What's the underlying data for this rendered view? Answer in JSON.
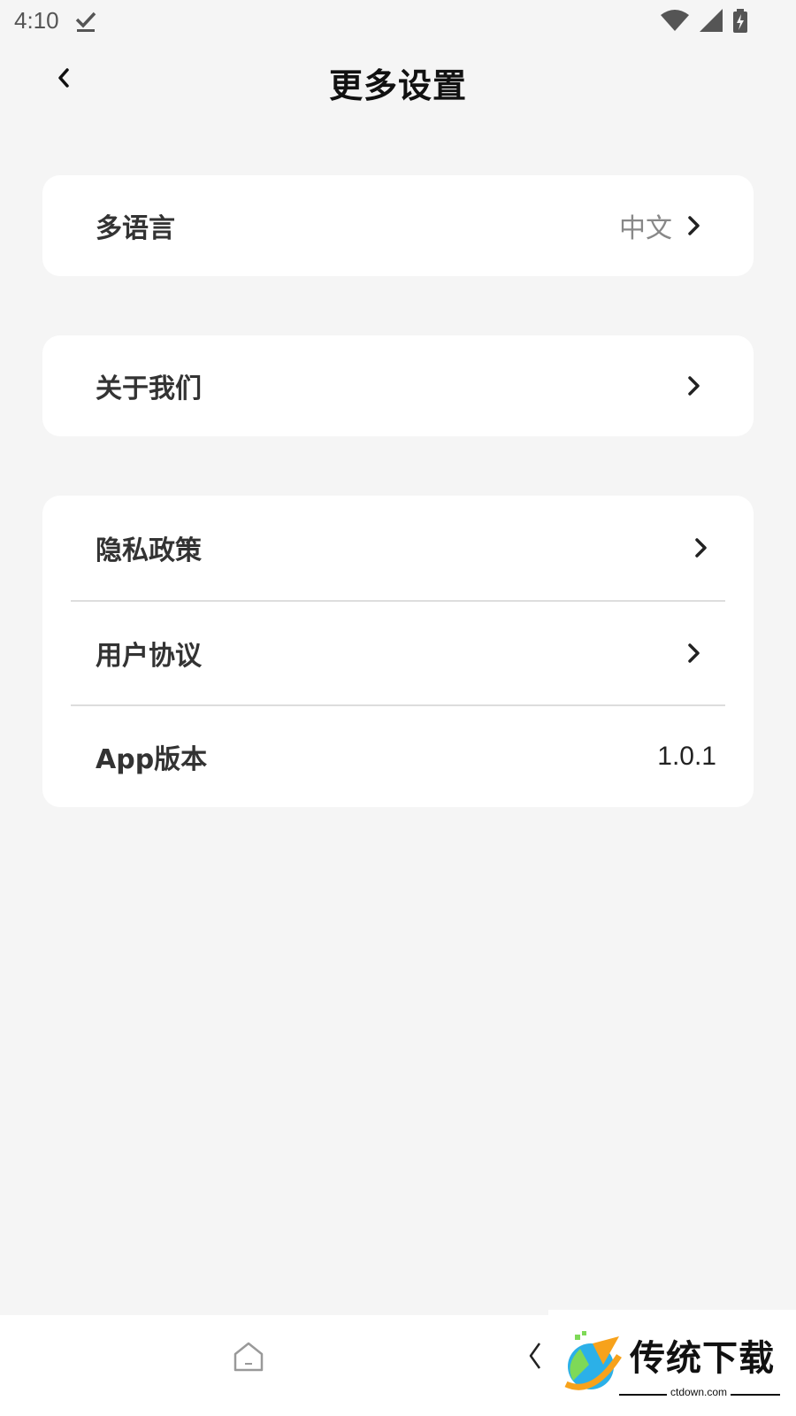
{
  "status_bar": {
    "time": "4:10",
    "icons": [
      "download-done-icon",
      "wifi-icon",
      "signal-icon",
      "battery-charging-icon"
    ]
  },
  "header": {
    "title": "更多设置",
    "back_icon": "chevron-left-icon"
  },
  "settings": {
    "language": {
      "label": "多语言",
      "value": "中文"
    },
    "about": {
      "label": "关于我们"
    },
    "privacy": {
      "label": "隐私政策"
    },
    "agreement": {
      "label": "用户协议"
    },
    "version": {
      "label": "App版本",
      "value": "1.0.1"
    }
  },
  "bottom_nav": {
    "icons": [
      "home-icon",
      "back-icon"
    ]
  },
  "watermark": {
    "name": "传统下载",
    "url": "ctdown.com"
  },
  "colors": {
    "background": "#f5f5f5",
    "card": "#ffffff",
    "label": "#333333",
    "secondary": "#888888",
    "divider": "#dddddd"
  }
}
